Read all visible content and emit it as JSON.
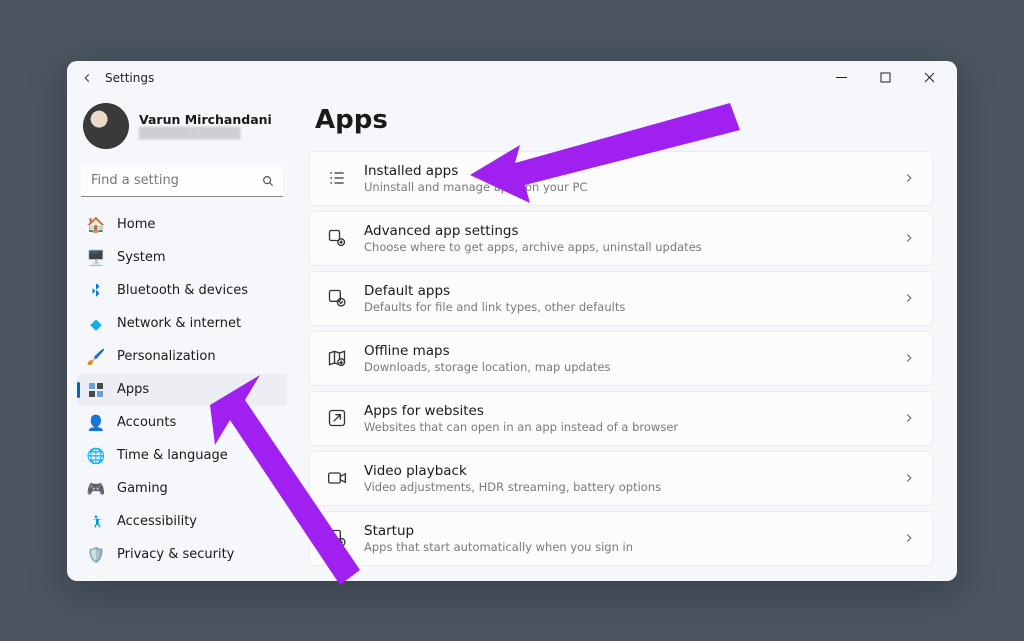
{
  "titlebar": {
    "title": "Settings"
  },
  "profile": {
    "name": "Varun Mirchandani",
    "email_placeholder": "████████████"
  },
  "search": {
    "placeholder": "Find a setting"
  },
  "sidebar": {
    "items": [
      {
        "id": "home",
        "label": "Home"
      },
      {
        "id": "system",
        "label": "System"
      },
      {
        "id": "bluetooth",
        "label": "Bluetooth & devices"
      },
      {
        "id": "network",
        "label": "Network & internet"
      },
      {
        "id": "personalization",
        "label": "Personalization"
      },
      {
        "id": "apps",
        "label": "Apps",
        "active": true
      },
      {
        "id": "accounts",
        "label": "Accounts"
      },
      {
        "id": "time",
        "label": "Time & language"
      },
      {
        "id": "gaming",
        "label": "Gaming"
      },
      {
        "id": "accessibility",
        "label": "Accessibility"
      },
      {
        "id": "privacy",
        "label": "Privacy & security"
      }
    ]
  },
  "page": {
    "title": "Apps"
  },
  "cards": [
    {
      "id": "installed",
      "title": "Installed apps",
      "subtitle": "Uninstall and manage apps on your PC"
    },
    {
      "id": "advanced",
      "title": "Advanced app settings",
      "subtitle": "Choose where to get apps, archive apps, uninstall updates"
    },
    {
      "id": "default",
      "title": "Default apps",
      "subtitle": "Defaults for file and link types, other defaults"
    },
    {
      "id": "offline",
      "title": "Offline maps",
      "subtitle": "Downloads, storage location, map updates"
    },
    {
      "id": "websites",
      "title": "Apps for websites",
      "subtitle": "Websites that can open in an app instead of a browser"
    },
    {
      "id": "video",
      "title": "Video playback",
      "subtitle": "Video adjustments, HDR streaming, battery options"
    },
    {
      "id": "startup",
      "title": "Startup",
      "subtitle": "Apps that start automatically when you sign in"
    }
  ],
  "annotation": {
    "arrow_color": "#A020F0"
  }
}
